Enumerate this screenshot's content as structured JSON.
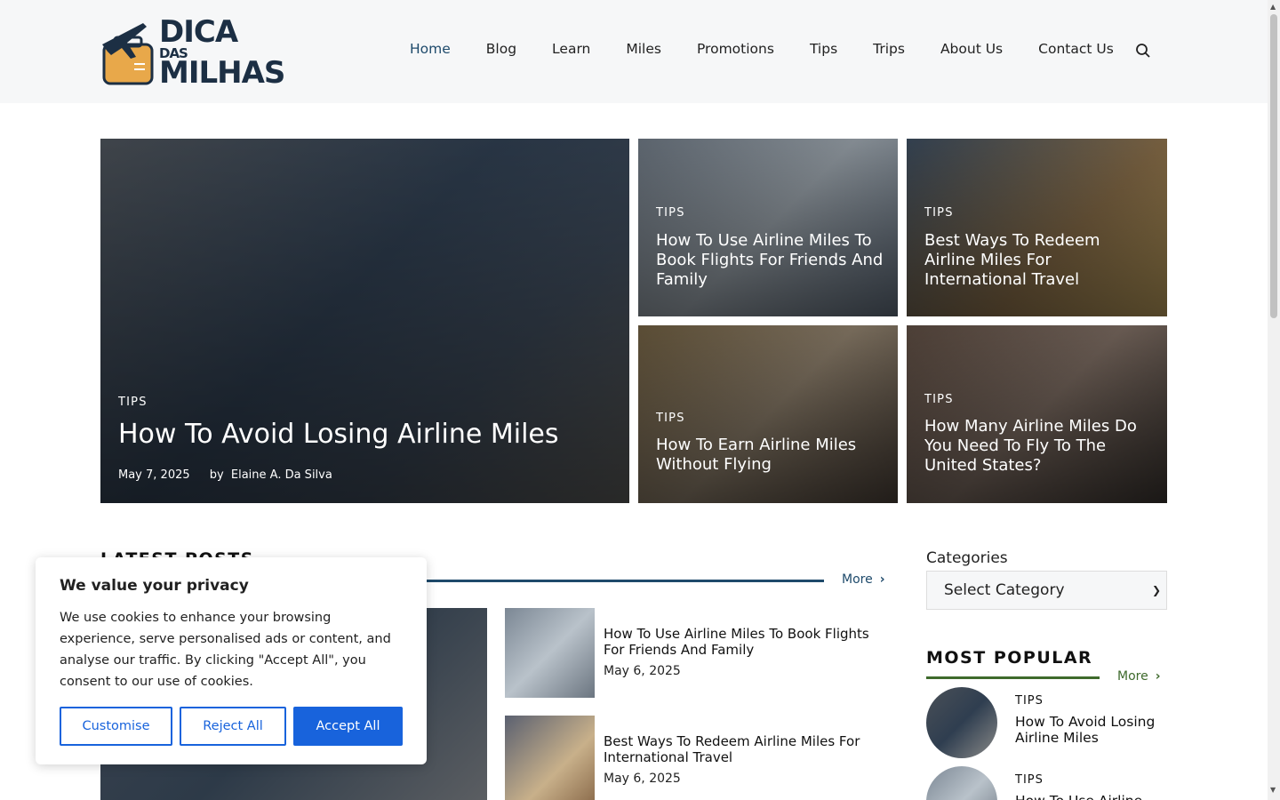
{
  "header": {
    "logo": {
      "line1": "DICA",
      "line2": "DAS",
      "line3": "MILHAS"
    },
    "nav": [
      {
        "label": "Home",
        "active": true
      },
      {
        "label": "Blog"
      },
      {
        "label": "Learn"
      },
      {
        "label": "Miles"
      },
      {
        "label": "Promotions"
      },
      {
        "label": "Tips"
      },
      {
        "label": "Trips"
      },
      {
        "label": "About Us"
      },
      {
        "label": "Contact Us"
      }
    ],
    "search_icon": "search-icon"
  },
  "hero": {
    "main": {
      "category": "TIPS",
      "title": "How To Avoid Losing Airline Miles",
      "date": "May 7, 2025",
      "by": "by",
      "author": "Elaine A. Da Silva"
    },
    "tiles": [
      {
        "category": "TIPS",
        "title": "How To Use Airline Miles To Book Flights For Friends And Family"
      },
      {
        "category": "TIPS",
        "title": "Best Ways To Redeem Airline Miles For International Travel"
      },
      {
        "category": "TIPS",
        "title": "How To Earn Airline Miles Without Flying"
      },
      {
        "category": "TIPS",
        "title": "How Many Airline Miles Do You Need To Fly To The United States?"
      }
    ]
  },
  "latest": {
    "title": "LATEST POSTS",
    "more": "More",
    "posts": [
      {
        "title": "How To Use Airline Miles To Book Flights For Friends And Family",
        "date": "May 6, 2025"
      },
      {
        "title": "Best Ways To Redeem Airline Miles For International Travel",
        "date": "May 6, 2025"
      }
    ]
  },
  "sidebar": {
    "categories_label": "Categories",
    "select_value": "Select Category",
    "popular_title": "MOST POPULAR",
    "more": "More",
    "popular": [
      {
        "category": "TIPS",
        "title": "How To Avoid Losing Airline Miles"
      },
      {
        "category": "TIPS",
        "title": "How To Use Airline"
      }
    ]
  },
  "cookie": {
    "title": "We value your privacy",
    "text": "We use cookies to enhance your browsing experience, serve personalised ads or content, and analyse our traffic. By clicking \"Accept All\", you consent to our use of cookies.",
    "customise": "Customise",
    "reject": "Reject All",
    "accept": "Accept All"
  },
  "colors": {
    "accent": "#1e4a6b",
    "cookie_button": "#1863dc",
    "popular_line": "#3e6a2c",
    "logo_orange": "#e8a84a"
  }
}
